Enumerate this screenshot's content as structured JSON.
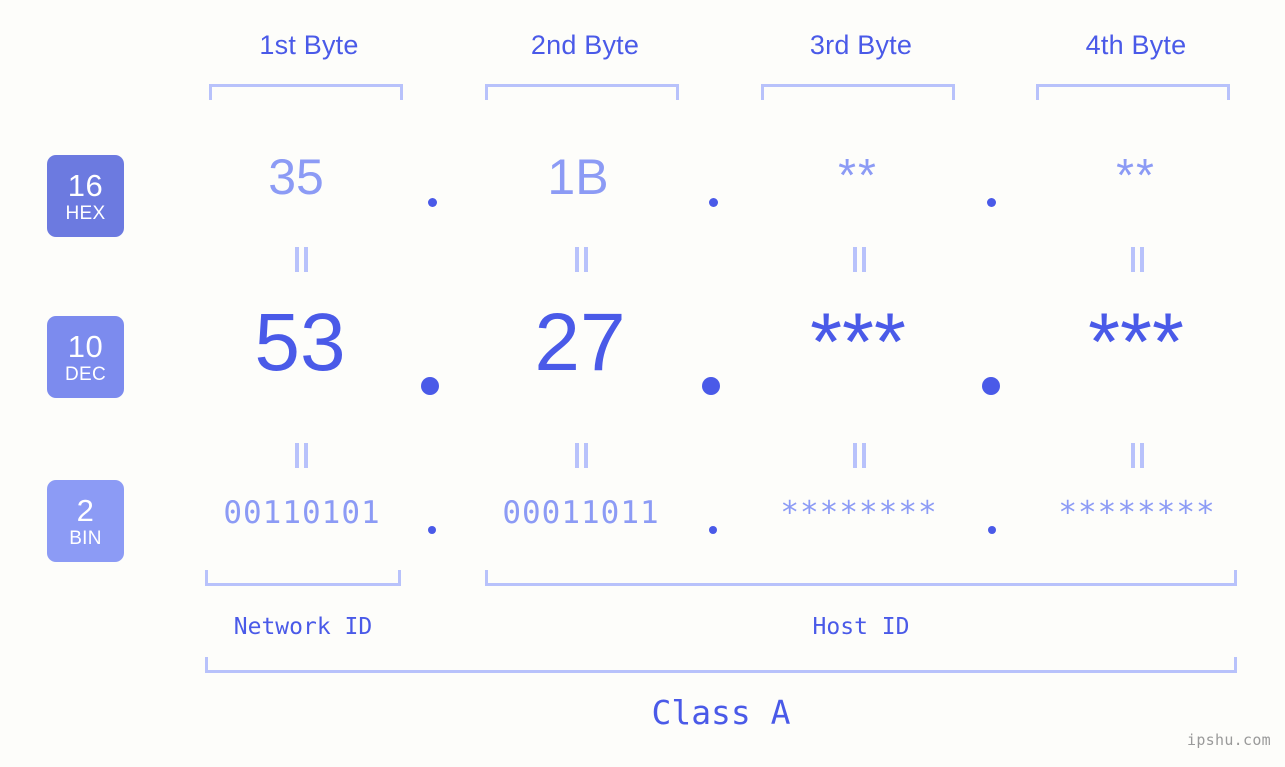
{
  "meta": {
    "watermark": "ipshu.com",
    "background_color": "#fdfdfa",
    "accent_strong": "#4a5ae8",
    "accent_light": "#8c9bf5",
    "bracket_color": "#b8c2fb"
  },
  "byte_headers": [
    {
      "label": "1st Byte"
    },
    {
      "label": "2nd Byte"
    },
    {
      "label": "3rd Byte"
    },
    {
      "label": "4th Byte"
    }
  ],
  "bases": [
    {
      "number": "16",
      "name": "HEX",
      "color": "#6c7ae0"
    },
    {
      "number": "10",
      "name": "DEC",
      "color": "#7c8bee"
    },
    {
      "number": "2",
      "name": "BIN",
      "color": "#8c9bf5"
    }
  ],
  "rows": {
    "hex": {
      "base": "16",
      "name": "HEX",
      "values": [
        "35",
        "1B",
        "**",
        "**"
      ]
    },
    "dec": {
      "base": "10",
      "name": "DEC",
      "values": [
        "53",
        "27",
        "***",
        "***"
      ]
    },
    "bin": {
      "base": "2",
      "name": "BIN",
      "values": [
        "00110101",
        "00011011",
        "********",
        "********"
      ]
    }
  },
  "separator": ".",
  "segments": {
    "network_id": "Network ID",
    "host_id": "Host ID"
  },
  "class_label": "Class A",
  "chart_data": {
    "type": "table",
    "title": "IP address byte breakdown — Class A",
    "categories": [
      "1st Byte",
      "2nd Byte",
      "3rd Byte",
      "4th Byte"
    ],
    "series": [
      {
        "name": "HEX",
        "values": [
          "35",
          "1B",
          "**",
          "**"
        ]
      },
      {
        "name": "DEC",
        "values": [
          "53",
          "27",
          "***",
          "***"
        ]
      },
      {
        "name": "BIN",
        "values": [
          "00110101",
          "00011011",
          "********",
          "********"
        ]
      }
    ],
    "annotations": [
      "Network ID",
      "Host ID",
      "Class A"
    ]
  }
}
